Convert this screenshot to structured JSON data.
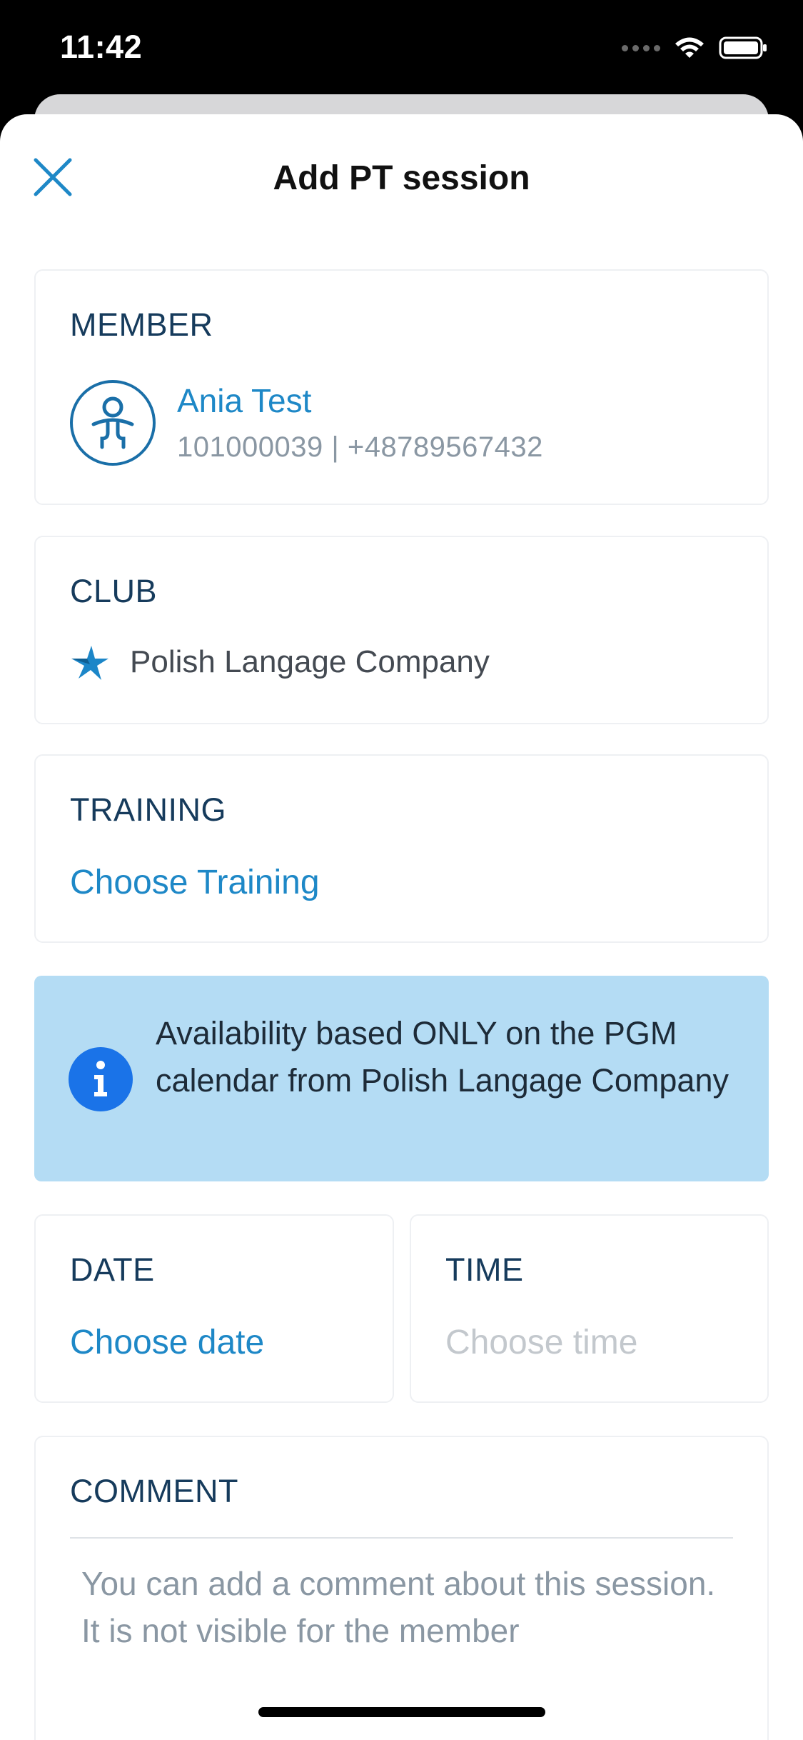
{
  "status_bar": {
    "time": "11:42"
  },
  "header": {
    "title": "Add PT session",
    "close_icon": "close-icon"
  },
  "member": {
    "label": "MEMBER",
    "name": "Ania Test",
    "meta": "101000039 | +48789567432",
    "avatar_icon": "person-icon"
  },
  "club": {
    "label": "CLUB",
    "name": "Polish Langage Company",
    "icon": "star-logo-icon"
  },
  "training": {
    "label": "TRAINING",
    "action": "Choose Training"
  },
  "info": {
    "icon": "info-icon",
    "text": "Availability based ONLY on the PGM calendar from Polish Langage Company"
  },
  "date": {
    "label": "DATE",
    "action": "Choose date"
  },
  "time": {
    "label": "TIME",
    "placeholder": "Choose time"
  },
  "comment": {
    "label": "COMMENT",
    "placeholder": "You can add a comment about this session. It is not visible for the member"
  },
  "colors": {
    "accent": "#1e88c7",
    "info_background": "#b4dcf4",
    "info_icon": "#1a73e8",
    "label": "#163b5c"
  }
}
